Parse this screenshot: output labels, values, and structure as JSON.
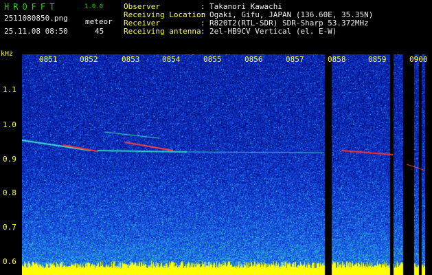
{
  "header": {
    "app_name": "HROFFT",
    "version": "1.0.0",
    "filename": "2511080850.png",
    "datetime": "25.11.08 08:50",
    "meteor_label": "meteor",
    "meteor_count": "45",
    "info": [
      {
        "label": "Observer",
        "value": "Takanori Kawachi"
      },
      {
        "label": "Receiving Location",
        "value": "Ogaki, Gifu, JAPAN (136.60E, 35.35N)"
      },
      {
        "label": "Receiver",
        "value": "R820T2(RTL-SDR) SDR-Sharp 53.372MHz"
      },
      {
        "label": "Receiving antenna",
        "value": "2el-HB9CV Vertical (el. E-W)"
      }
    ],
    "separator": ":"
  },
  "axis": {
    "y_unit": "kHz",
    "y_ticks": [
      "1.1",
      "1.0",
      "0.9",
      "0.8",
      "0.7",
      "0.6"
    ],
    "x_ticks": [
      "0851",
      "0852",
      "0853",
      "0854",
      "0855",
      "0856",
      "0857",
      "0858",
      "0859",
      "0900"
    ]
  },
  "colors": {
    "background": "#000000",
    "noise_dark": "#0a1fa0",
    "signal": "#ff2020",
    "axis_text": "#ffff40",
    "title_text": "#27d300"
  }
}
